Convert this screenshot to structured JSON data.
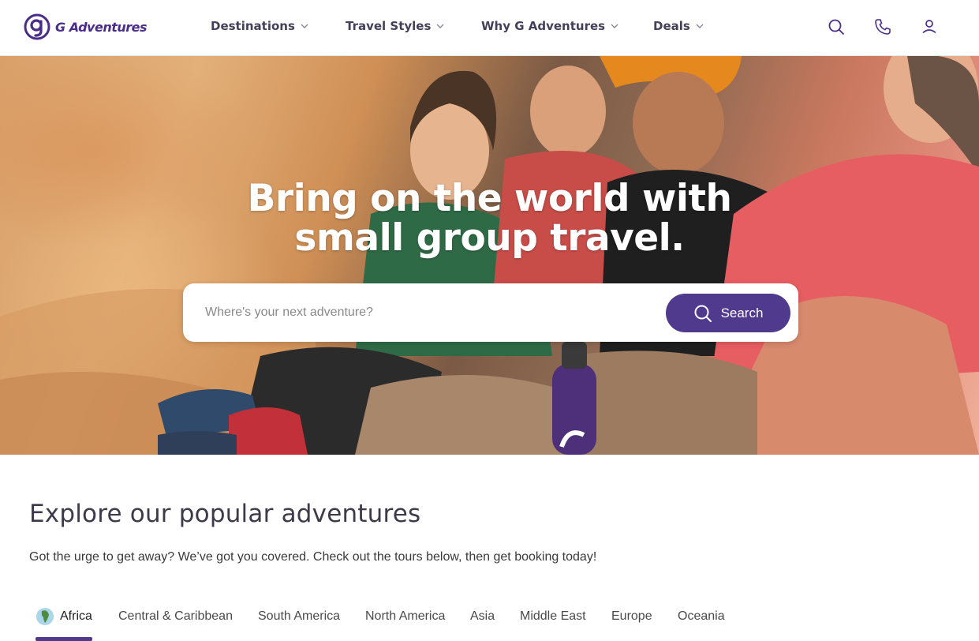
{
  "brand": {
    "name": "G Adventures",
    "accent_color": "#503a8e",
    "logo_icon": "g-logo-icon"
  },
  "nav": {
    "items": [
      {
        "label": "Destinations"
      },
      {
        "label": "Travel Styles"
      },
      {
        "label": "Why G Adventures"
      },
      {
        "label": "Deals"
      }
    ],
    "icons": [
      "search-icon",
      "phone-icon",
      "user-icon"
    ]
  },
  "hero": {
    "title_line1": "Bring on the world with",
    "title_line2": "small group travel.",
    "search": {
      "placeholder": "Where's your next adventure?",
      "value": "",
      "button_label": "Search"
    }
  },
  "explore": {
    "title": "Explore our popular adventures",
    "subtitle": "Got the urge to get away? We’ve got you covered. Check out the tours below, then get booking today!",
    "tabs": [
      {
        "label": "Africa",
        "active": true
      },
      {
        "label": "Central & Caribbean"
      },
      {
        "label": "South America"
      },
      {
        "label": "North America"
      },
      {
        "label": "Asia"
      },
      {
        "label": "Middle East"
      },
      {
        "label": "Europe"
      },
      {
        "label": "Oceania"
      }
    ]
  }
}
